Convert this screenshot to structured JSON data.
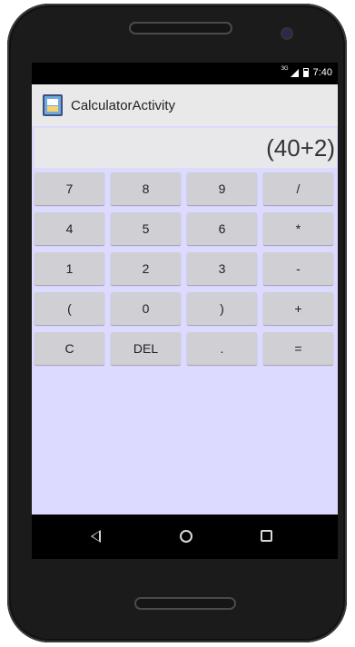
{
  "status_bar": {
    "network": "3G",
    "time": "7:40"
  },
  "action_bar": {
    "title": "CalculatorActivity"
  },
  "display": {
    "value": "(40+2)"
  },
  "keypad": {
    "rows": [
      [
        "7",
        "8",
        "9",
        "/"
      ],
      [
        "4",
        "5",
        "6",
        "*"
      ],
      [
        "1",
        "2",
        "3",
        "-"
      ],
      [
        "(",
        "0",
        ")",
        "+"
      ],
      [
        "C",
        "DEL",
        ".",
        "="
      ]
    ]
  },
  "colors": {
    "screen_bg": "#dcdaff",
    "key_bg": "#cfcfd4",
    "action_bar_bg": "#e9e9ea"
  },
  "nav_bar": {
    "icons": [
      "back-icon",
      "home-icon",
      "recents-icon"
    ]
  }
}
